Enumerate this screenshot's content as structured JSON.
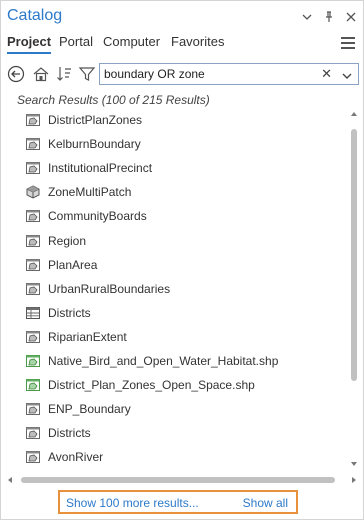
{
  "panel": {
    "title": "Catalog",
    "tabs": [
      "Project",
      "Portal",
      "Computer",
      "Favorites"
    ],
    "active_tab": "Project"
  },
  "toolbar": {
    "search_value": "boundary OR zone",
    "clear_glyph": "✕"
  },
  "results": {
    "label": "Search Results (100 of 215 Results)",
    "items": [
      {
        "label": "DistrictPlanZones",
        "icon": "polygon-feature-class-icon"
      },
      {
        "label": "KelburnBoundary",
        "icon": "polygon-feature-class-icon"
      },
      {
        "label": "InstitutionalPrecinct",
        "icon": "polygon-feature-class-icon"
      },
      {
        "label": "ZoneMultiPatch",
        "icon": "multipatch-icon"
      },
      {
        "label": "CommunityBoards",
        "icon": "polygon-feature-class-icon"
      },
      {
        "label": "Region",
        "icon": "polygon-feature-class-icon"
      },
      {
        "label": "PlanArea",
        "icon": "polygon-feature-class-icon"
      },
      {
        "label": "UrbanRuralBoundaries",
        "icon": "polygon-feature-class-icon"
      },
      {
        "label": "Districts",
        "icon": "table-icon"
      },
      {
        "label": "RiparianExtent",
        "icon": "polygon-feature-class-icon"
      },
      {
        "label": "Native_Bird_and_Open_Water_Habitat.shp",
        "icon": "shapefile-icon"
      },
      {
        "label": "District_Plan_Zones_Open_Space.shp",
        "icon": "shapefile-icon"
      },
      {
        "label": "ENP_Boundary",
        "icon": "polygon-feature-class-icon"
      },
      {
        "label": "Districts",
        "icon": "polygon-feature-class-icon"
      },
      {
        "label": "AvonRiver",
        "icon": "polygon-feature-class-icon"
      }
    ]
  },
  "footer": {
    "show_more": "Show 100 more results...",
    "show_all": "Show all"
  },
  "colors": {
    "accent": "#2c7ac9",
    "highlight_border": "#e8913a"
  }
}
